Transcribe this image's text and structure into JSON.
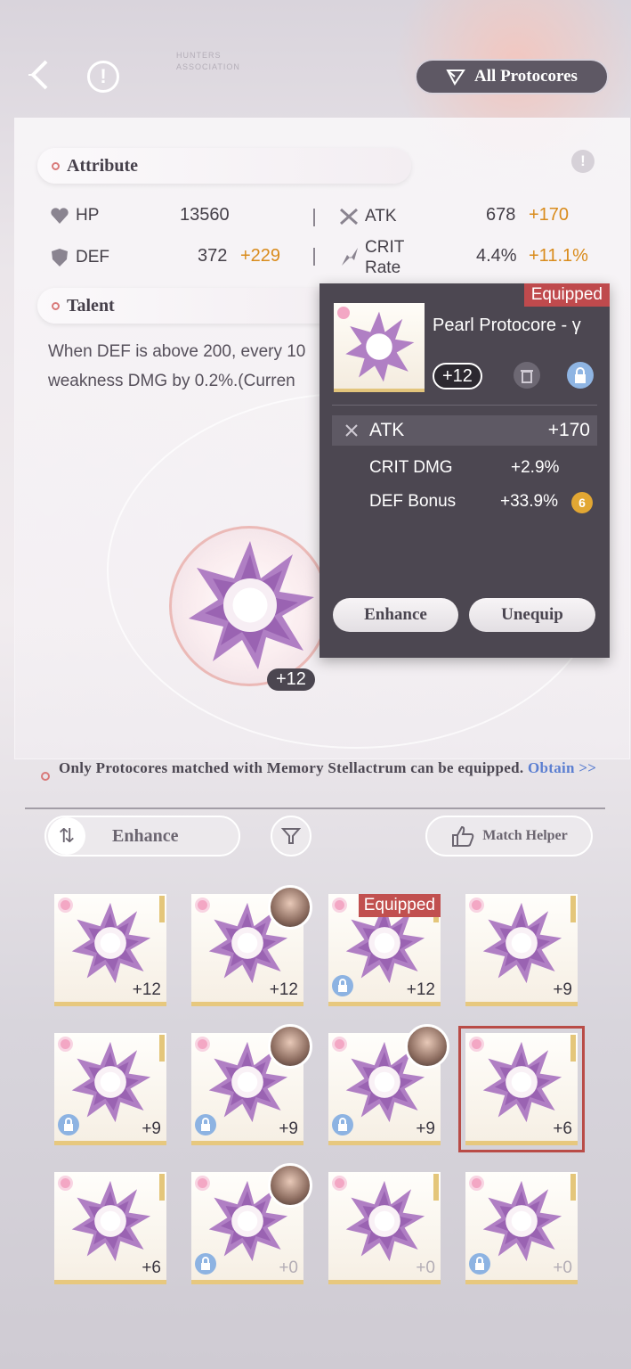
{
  "topbar": {
    "association_label": "HUNTERS\nASSOCIATION",
    "all_protocores_label": "All Protocores"
  },
  "attribute": {
    "title": "Attribute",
    "stats": [
      {
        "label": "HP",
        "value": "13560",
        "bonus": ""
      },
      {
        "label": "ATK",
        "value": "678",
        "bonus": "+170"
      },
      {
        "label": "DEF",
        "value": "372",
        "bonus": "+229"
      },
      {
        "label": "CRIT\nRate",
        "value": "4.4%",
        "bonus": "+11.1%"
      }
    ]
  },
  "talent": {
    "title": "Talent",
    "text_line1": "When DEF is above 200, every 10",
    "text_line2": "weakness DMG by 0.2%.(Curren"
  },
  "center_core": {
    "level": "+12"
  },
  "popup": {
    "equipped_tag": "Equipped",
    "name": "Pearl Protocore - γ",
    "level": "+12",
    "main_stat": {
      "label": "ATK",
      "value": "+170"
    },
    "sub_stats": [
      {
        "label": "CRIT DMG",
        "value": "+2.9%"
      },
      {
        "label": "DEF Bonus",
        "value": "+33.9%"
      }
    ],
    "sub_badge": "6",
    "enhance_label": "Enhance",
    "unequip_label": "Unequip"
  },
  "notice": {
    "text": "Only Protocores matched with Memory Stellactrum can be equipped.",
    "obtain_label": "Obtain >>"
  },
  "controls": {
    "enhance_label": "Enhance",
    "match_helper_label": "Match Helper"
  },
  "grid": [
    {
      "level": "+12",
      "locked": false,
      "avatar": false,
      "equipped": false,
      "selected": false
    },
    {
      "level": "+12",
      "locked": false,
      "avatar": true,
      "equipped": false,
      "selected": false
    },
    {
      "level": "+12",
      "locked": true,
      "avatar": false,
      "equipped": true,
      "selected": false
    },
    {
      "level": "+9",
      "locked": false,
      "avatar": false,
      "equipped": false,
      "selected": false
    },
    {
      "level": "+9",
      "locked": true,
      "avatar": false,
      "equipped": false,
      "selected": false
    },
    {
      "level": "+9",
      "locked": true,
      "avatar": true,
      "equipped": false,
      "selected": false
    },
    {
      "level": "+9",
      "locked": true,
      "avatar": true,
      "equipped": false,
      "selected": false
    },
    {
      "level": "+6",
      "locked": false,
      "avatar": false,
      "equipped": false,
      "selected": true
    },
    {
      "level": "+6",
      "locked": false,
      "avatar": false,
      "equipped": false,
      "selected": false
    },
    {
      "level": "+0",
      "locked": true,
      "avatar": true,
      "equipped": false,
      "selected": false
    },
    {
      "level": "+0",
      "locked": false,
      "avatar": false,
      "equipped": false,
      "selected": false
    },
    {
      "level": "+0",
      "locked": true,
      "avatar": false,
      "equipped": false,
      "selected": false
    }
  ],
  "grid_equipped_label": "Equipped",
  "colors": {
    "accent_orange": "#d98b1c",
    "equipped_red": "#c1504f",
    "obtain_blue": "#5c7fd1",
    "popup_bg": "#4c4751"
  }
}
